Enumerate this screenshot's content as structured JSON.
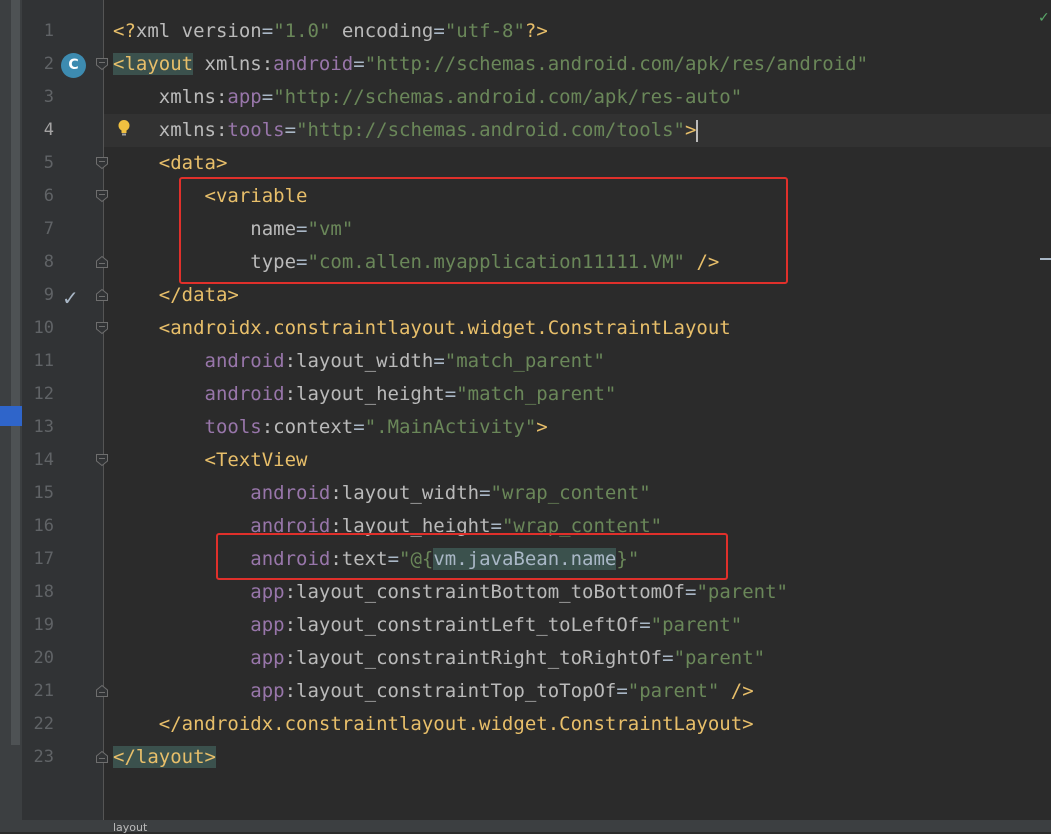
{
  "editor": {
    "lines": [
      {
        "no": "1",
        "segments": [
          {
            "c": "p",
            "t": "<?"
          },
          {
            "c": "a",
            "t": "xml version"
          },
          {
            "c": "d",
            "t": "="
          },
          {
            "c": "v",
            "t": "\"1.0\""
          },
          {
            "c": "d",
            "t": " "
          },
          {
            "c": "a",
            "t": "encoding"
          },
          {
            "c": "d",
            "t": "="
          },
          {
            "c": "v",
            "t": "\"utf-8\""
          },
          {
            "c": "p",
            "t": "?>"
          }
        ]
      },
      {
        "no": "2",
        "segments": [
          {
            "c": "th",
            "t": "<layout"
          },
          {
            "c": "d",
            "t": " "
          },
          {
            "c": "a",
            "t": "xmlns:"
          },
          {
            "c": "ns",
            "t": "android"
          },
          {
            "c": "d",
            "t": "="
          },
          {
            "c": "v",
            "t": "\"http://schemas.android.com/apk/res/android\""
          }
        ]
      },
      {
        "no": "3",
        "segments": [
          {
            "c": "d",
            "t": "    "
          },
          {
            "c": "a",
            "t": "xmlns:"
          },
          {
            "c": "ns",
            "t": "app"
          },
          {
            "c": "d",
            "t": "="
          },
          {
            "c": "v",
            "t": "\"http://schemas.android.com/apk/res-auto\""
          }
        ]
      },
      {
        "no": "4",
        "segments": [
          {
            "c": "d",
            "t": "    "
          },
          {
            "c": "a",
            "t": "xmlns:"
          },
          {
            "c": "ns",
            "t": "tools"
          },
          {
            "c": "d",
            "t": "="
          },
          {
            "c": "v",
            "t": "\"http://schemas.android.com/tools\""
          },
          {
            "c": "t",
            "t": ">"
          }
        ]
      },
      {
        "no": "5",
        "segments": [
          {
            "c": "d",
            "t": "    "
          },
          {
            "c": "t",
            "t": "<data>"
          }
        ]
      },
      {
        "no": "6",
        "segments": [
          {
            "c": "d",
            "t": "        "
          },
          {
            "c": "t",
            "t": "<variable"
          }
        ]
      },
      {
        "no": "7",
        "segments": [
          {
            "c": "d",
            "t": "            "
          },
          {
            "c": "a",
            "t": "name"
          },
          {
            "c": "d",
            "t": "="
          },
          {
            "c": "v",
            "t": "\"vm\""
          }
        ]
      },
      {
        "no": "8",
        "segments": [
          {
            "c": "d",
            "t": "            "
          },
          {
            "c": "a",
            "t": "type"
          },
          {
            "c": "d",
            "t": "="
          },
          {
            "c": "v",
            "t": "\"com.allen.myapplication11111.VM\""
          },
          {
            "c": "d",
            "t": " "
          },
          {
            "c": "t",
            "t": "/>"
          }
        ]
      },
      {
        "no": "9",
        "segments": [
          {
            "c": "d",
            "t": "    "
          },
          {
            "c": "t",
            "t": "</data>"
          }
        ]
      },
      {
        "no": "10",
        "segments": [
          {
            "c": "d",
            "t": "    "
          },
          {
            "c": "t",
            "t": "<androidx.constraintlayout.widget.ConstraintLayout"
          }
        ]
      },
      {
        "no": "11",
        "segments": [
          {
            "c": "d",
            "t": "        "
          },
          {
            "c": "ns",
            "t": "android"
          },
          {
            "c": "a",
            "t": ":layout_width"
          },
          {
            "c": "d",
            "t": "="
          },
          {
            "c": "v",
            "t": "\"match_parent\""
          }
        ]
      },
      {
        "no": "12",
        "segments": [
          {
            "c": "d",
            "t": "        "
          },
          {
            "c": "ns",
            "t": "android"
          },
          {
            "c": "a",
            "t": ":layout_height"
          },
          {
            "c": "d",
            "t": "="
          },
          {
            "c": "v",
            "t": "\"match_parent\""
          }
        ]
      },
      {
        "no": "13",
        "segments": [
          {
            "c": "d",
            "t": "        "
          },
          {
            "c": "ns",
            "t": "tools"
          },
          {
            "c": "a",
            "t": ":context"
          },
          {
            "c": "d",
            "t": "="
          },
          {
            "c": "v",
            "t": "\".MainActivity\""
          },
          {
            "c": "t",
            "t": ">"
          }
        ]
      },
      {
        "no": "14",
        "segments": [
          {
            "c": "d",
            "t": "        "
          },
          {
            "c": "t",
            "t": "<TextView"
          }
        ]
      },
      {
        "no": "15",
        "segments": [
          {
            "c": "d",
            "t": "            "
          },
          {
            "c": "ns",
            "t": "android"
          },
          {
            "c": "a",
            "t": ":layout_width"
          },
          {
            "c": "d",
            "t": "="
          },
          {
            "c": "v",
            "t": "\"wrap_content\""
          }
        ]
      },
      {
        "no": "16",
        "segments": [
          {
            "c": "d",
            "t": "            "
          },
          {
            "c": "ns",
            "t": "android"
          },
          {
            "c": "a",
            "t": ":layout_height"
          },
          {
            "c": "d",
            "t": "="
          },
          {
            "c": "v",
            "t": "\"wrap_content\""
          }
        ]
      },
      {
        "no": "17",
        "segments": [
          {
            "c": "d",
            "t": "            "
          },
          {
            "c": "ns",
            "t": "android"
          },
          {
            "c": "a",
            "t": ":text"
          },
          {
            "c": "d",
            "t": "="
          },
          {
            "c": "v",
            "t": "\"@{"
          },
          {
            "c": "e",
            "t": "vm.javaBean.name"
          },
          {
            "c": "v",
            "t": "}\""
          }
        ]
      },
      {
        "no": "18",
        "segments": [
          {
            "c": "d",
            "t": "            "
          },
          {
            "c": "ns",
            "t": "app"
          },
          {
            "c": "a",
            "t": ":layout_constraintBottom_toBottomOf"
          },
          {
            "c": "d",
            "t": "="
          },
          {
            "c": "v",
            "t": "\"parent\""
          }
        ]
      },
      {
        "no": "19",
        "segments": [
          {
            "c": "d",
            "t": "            "
          },
          {
            "c": "ns",
            "t": "app"
          },
          {
            "c": "a",
            "t": ":layout_constraintLeft_toLeftOf"
          },
          {
            "c": "d",
            "t": "="
          },
          {
            "c": "v",
            "t": "\"parent\""
          }
        ]
      },
      {
        "no": "20",
        "segments": [
          {
            "c": "d",
            "t": "            "
          },
          {
            "c": "ns",
            "t": "app"
          },
          {
            "c": "a",
            "t": ":layout_constraintRight_toRightOf"
          },
          {
            "c": "d",
            "t": "="
          },
          {
            "c": "v",
            "t": "\"parent\""
          }
        ]
      },
      {
        "no": "21",
        "segments": [
          {
            "c": "d",
            "t": "            "
          },
          {
            "c": "ns",
            "t": "app"
          },
          {
            "c": "a",
            "t": ":layout_constraintTop_toTopOf"
          },
          {
            "c": "d",
            "t": "="
          },
          {
            "c": "v",
            "t": "\"parent\""
          },
          {
            "c": "d",
            "t": " "
          },
          {
            "c": "t",
            "t": "/>"
          }
        ]
      },
      {
        "no": "22",
        "segments": [
          {
            "c": "d",
            "t": "    "
          },
          {
            "c": "t",
            "t": "</androidx.constraintlayout.widget.ConstraintLayout>"
          }
        ]
      },
      {
        "no": "23",
        "segments": [
          {
            "c": "th",
            "t": "</layout>"
          }
        ]
      }
    ]
  },
  "gutter": {
    "class_icon_letter": "C",
    "class_icon_name": "class-icon",
    "bulb_icon_name": "lightbulb-icon",
    "check_icon_name": "checkmark-icon",
    "check_glyph": "✓"
  },
  "status": {
    "corner_check": "✓",
    "breadcrumb": "layout"
  },
  "colors": {
    "background": "#2b2b2b",
    "tag": "#e8bf6a",
    "attribute": "#bababa",
    "namespace": "#9876aa",
    "string": "#6a8759",
    "annotation_box": "#e0302b"
  }
}
